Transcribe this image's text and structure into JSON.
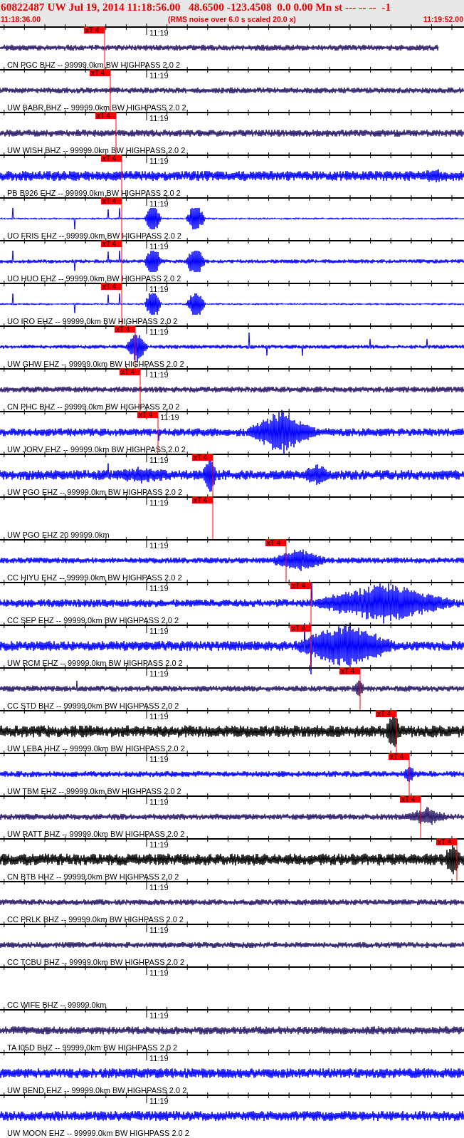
{
  "header": {
    "title": "60822487 UW Jul 19, 2014 11:18:56.00   48.6500 -123.4508  0.0 0.00 Mn st --- -- --  -1",
    "start_time": "11:18:36.00",
    "note": "(RMS noise over 6.0 s scaled 20.0 x)",
    "end_time": "11:19:52.00"
  },
  "traces": [
    {
      "kind": "signal",
      "color": "#2a1868",
      "time_label": "11:19",
      "pick": "xT 4",
      "station": "CN PGC BHZ -- 99999.0km BW HIGHPASS 2.0 2"
    },
    {
      "kind": "signal",
      "color": "#2a1868",
      "time_label": "11:19",
      "pick": "xT 4",
      "station": "UW BABR BHZ -- 99999.0km BW HIGHPASS 2.0 2"
    },
    {
      "kind": "signal",
      "color": "#2a1868",
      "time_label": "11:19",
      "pick": "xT 4",
      "station": "UW WISH BHZ -- 99999.0km BW HIGHPASS 2.0 2"
    },
    {
      "kind": "signal",
      "color": "#0000ff",
      "time_label": "11:19",
      "pick": "xT 4",
      "station": "PB B926 EHZ -- 99999.0km BW HIGHPASS 2.0 2"
    },
    {
      "kind": "signal",
      "color": "#0000ff",
      "time_label": "11:19",
      "pick": "xT 4",
      "station": "UO FRIS EHZ -- 99999.0km BW HIGHPASS 2.0 2"
    },
    {
      "kind": "signal",
      "color": "#0000ff",
      "time_label": "11:19",
      "pick": "xT 4",
      "station": "UO HUO EHZ -- 99999.0km BW HIGHPASS 2.0 2"
    },
    {
      "kind": "signal",
      "color": "#0000ff",
      "time_label": "11:19",
      "pick": "xT 4",
      "station": "UO IRO EHZ -- 99999.0km BW HIGHPASS 2.0 2"
    },
    {
      "kind": "signal",
      "color": "#0000ff",
      "time_label": "11:19",
      "pick": "xT 4",
      "station": "UW GHW EHZ -- 99999.0km BW HIGHPASS 2.0 2"
    },
    {
      "kind": "signal",
      "color": "#2a1868",
      "time_label": "11:19",
      "pick": "xT 4",
      "station": "CN PHC BHZ -- 99999.0km BW HIGHPASS 2.0 2"
    },
    {
      "kind": "signal",
      "color": "#0000ff",
      "time_label": "11:19",
      "pick": "xT 4",
      "station": "UW JORV EHZ -- 99999.0km BW HIGHPASS 2.0 2"
    },
    {
      "kind": "signal",
      "color": "#0000ff",
      "time_label": "11:19",
      "pick": "xT 4",
      "station": "UW PGO EHZ -- 99999.0km BW HIGHPASS 2.0 2"
    },
    {
      "kind": "empty",
      "time_label": "11:19",
      "pick": "xT 4",
      "station": "UW PGO EHZ 20 99999.0km"
    },
    {
      "kind": "signal",
      "color": "#0000ff",
      "time_label": "11:19",
      "pick": "xT 4",
      "station": "CC HIYU EHZ -- 99999.0km BW HIGHPASS 2.0 2"
    },
    {
      "kind": "signal",
      "color": "#0000ff",
      "time_label": "11:19",
      "pick": "xT 4",
      "station": "CC SEP EHZ -- 99999.0km BW HIGHPASS 2.0 2"
    },
    {
      "kind": "signal",
      "color": "#0000ff",
      "time_label": "11:19",
      "pick": "xT 4",
      "station": "UW RCM EHZ -- 99999.0km BW HIGHPASS 2.0 2"
    },
    {
      "kind": "signal",
      "color": "#2a1868",
      "time_label": "11:19",
      "pick": "xT 4",
      "station": "CC STD BHZ -- 99999.0km BW HIGHPASS 2.0 2"
    },
    {
      "kind": "signal",
      "color": "#000000",
      "time_label": "11:19",
      "pick": "xT 4",
      "station": "UW LEBA HHZ -- 99999.0km BW HIGHPASS 2.0 2"
    },
    {
      "kind": "signal",
      "color": "#0000ff",
      "time_label": "11:19",
      "pick": "xT 4",
      "station": "UW TBM EHZ -- 99999.0km BW HIGHPASS 2.0 2"
    },
    {
      "kind": "signal",
      "color": "#2a1868",
      "time_label": "11:19",
      "pick": "xT 4",
      "station": "UW RATT BHZ -- 99999.0km BW HIGHPASS 2.0 2"
    },
    {
      "kind": "signal",
      "color": "#000000",
      "time_label": "11:19",
      "pick": "xT 4",
      "station": "CN BTB HHZ -- 99999.0km BW HIGHPASS 2.0 2"
    },
    {
      "kind": "signal",
      "color": "#2a1868",
      "time_label": "11:19",
      "station": "CC PRLK BHZ -- 99999.0km BW HIGHPASS 2.0 2"
    },
    {
      "kind": "signal",
      "color": "#2a1868",
      "time_label": "11:19",
      "station": "CC TCBU BHZ -- 99999.0km BW HIGHPASS 2.0 2"
    },
    {
      "kind": "empty",
      "time_label": "11:19",
      "station": "CC WIFE BHZ -- 99999.0km"
    },
    {
      "kind": "signal",
      "color": "#2a1868",
      "time_label": "11:19",
      "station": "TA I05D BHZ -- 99999.0km BW HIGHPASS 2.0 2"
    },
    {
      "kind": "signal",
      "color": "#0000ff",
      "time_label": "11:19",
      "station": "UW BEND EHZ -- 99999.0km BW HIGHPASS 2.0 2"
    },
    {
      "kind": "signal",
      "color": "#0000ff",
      "time_label": "11:19",
      "station": "UW MOON EHZ -- 99999.0km BW HIGHPASS 2.0 2"
    }
  ]
}
